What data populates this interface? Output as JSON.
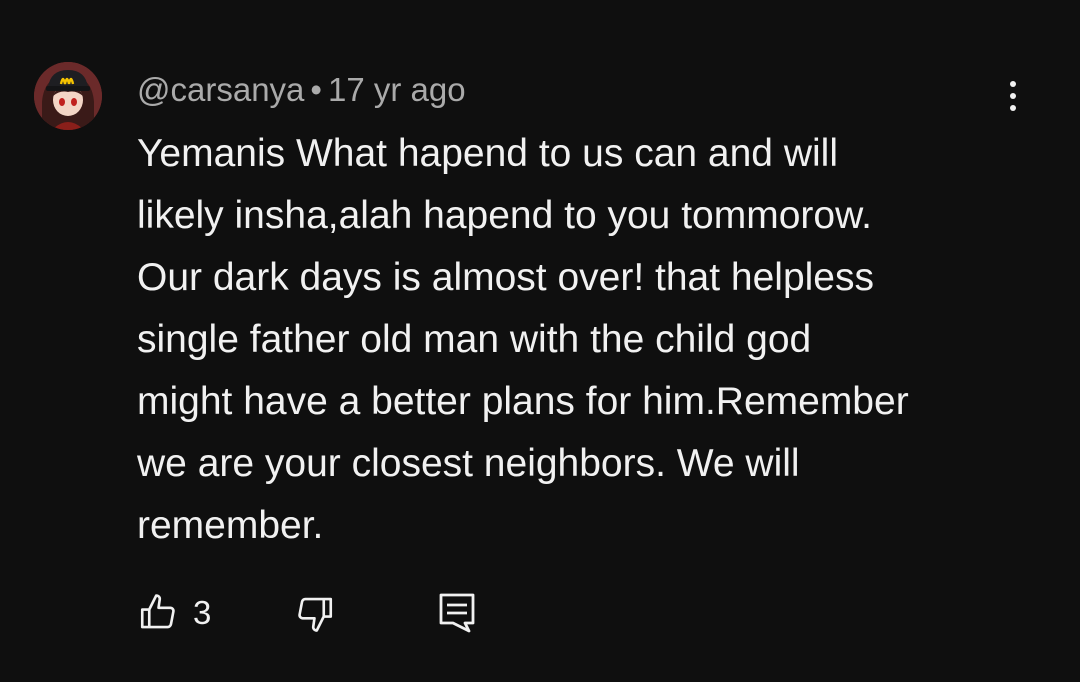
{
  "comment": {
    "author": "@carsanya",
    "separator": "•",
    "time": "17 yr ago",
    "lines": [
      "Yemanis What hapend to us can and will",
      "likely insha,alah hapend to you tommorow.",
      "Our dark days is almost over! that helpless",
      "single father old man with the child god",
      "might have a better plans for him.Remember",
      "we are your closest neighbors. We will",
      "remember."
    ],
    "like_count": "3"
  },
  "icons": {
    "more": "vertical-ellipsis-icon",
    "like": "thumbs-up-icon",
    "dislike": "thumbs-down-icon",
    "reply": "reply-comment-icon"
  },
  "colors": {
    "background": "#0f0f0f",
    "primary_text": "#f1f1f1",
    "secondary_text": "#aaaaaa"
  }
}
